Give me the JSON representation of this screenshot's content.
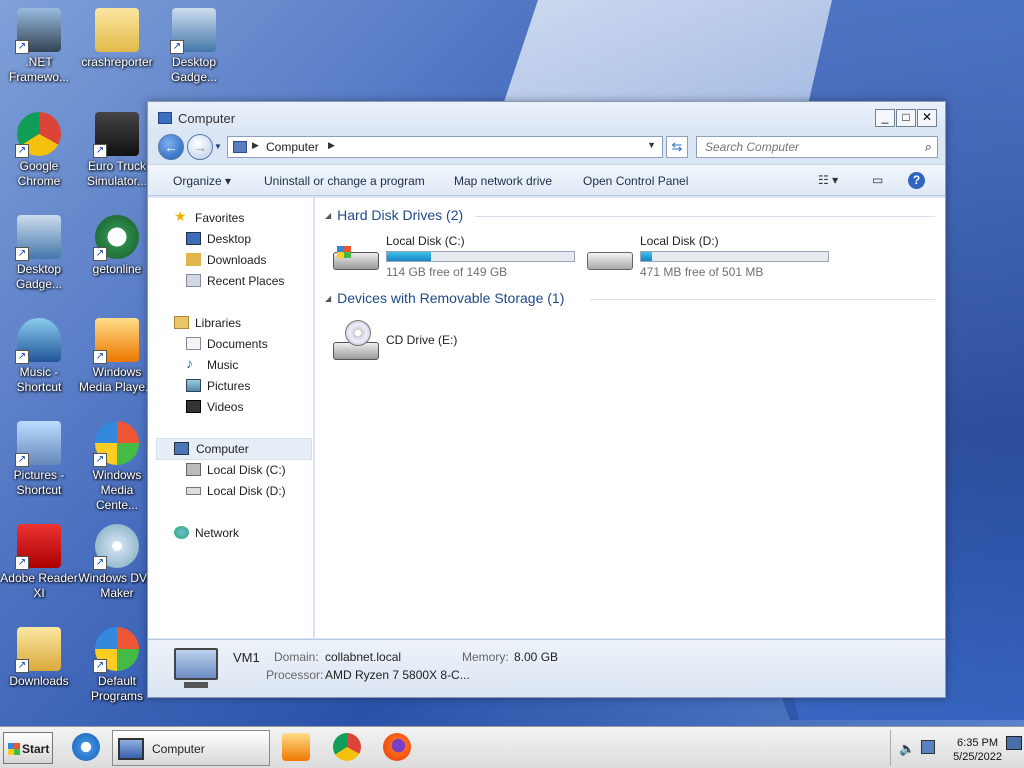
{
  "desktop": {
    "icons": [
      {
        "label": ".NET Framewo...",
        "icon": "net-framework-icon"
      },
      {
        "label": "crashreporter",
        "icon": "folder-icon"
      },
      {
        "label": "Desktop Gadge...",
        "icon": "desktop-gadget-icon"
      },
      {
        "label": "Google Chrome",
        "icon": "chrome-icon"
      },
      {
        "label": "Euro Truck Simulator...",
        "icon": "euro-truck-icon"
      },
      {
        "label": "Desktop Gadge...",
        "icon": "desktop-gadget-icon"
      },
      {
        "label": "getonline",
        "icon": "hp-icon"
      },
      {
        "label": "Music - Shortcut",
        "icon": "music-icon"
      },
      {
        "label": "Windows Media Playe...",
        "icon": "media-player-icon"
      },
      {
        "label": "Pictures - Shortcut",
        "icon": "pictures-icon"
      },
      {
        "label": "Windows Media Cente...",
        "icon": "media-center-icon"
      },
      {
        "label": "Adobe Reader XI",
        "icon": "adobe-reader-icon"
      },
      {
        "label": "Windows DVD Maker",
        "icon": "dvd-maker-icon"
      },
      {
        "label": "Downloads",
        "icon": "downloads-folder-icon"
      },
      {
        "label": "Default Programs",
        "icon": "default-programs-icon"
      }
    ]
  },
  "window": {
    "title": "Computer",
    "controls": {
      "minimize": "_",
      "maximize": "□",
      "close": "✕"
    },
    "address": {
      "crumb": "Computer"
    },
    "search": {
      "placeholder": "Search Computer"
    },
    "toolbar": {
      "organize": "Organize ▾",
      "uninstall": "Uninstall or change a program",
      "map_drive": "Map network drive",
      "control_panel": "Open Control Panel",
      "help": "?"
    },
    "nav": {
      "favorites": "Favorites",
      "desktop": "Desktop",
      "downloads": "Downloads",
      "recent": "Recent Places",
      "libraries": "Libraries",
      "documents": "Documents",
      "music": "Music",
      "pictures": "Pictures",
      "videos": "Videos",
      "computer": "Computer",
      "local_c": "Local Disk (C:)",
      "local_d": "Local Disk (D:)",
      "network": "Network"
    },
    "groups": {
      "hdd": "Hard Disk Drives (2)",
      "removable": "Devices with Removable Storage (1)"
    },
    "drives": [
      {
        "name": "Local Disk (C:)",
        "free": "114 GB free of 149 GB",
        "used_fraction": 0.235
      },
      {
        "name": "Local Disk (D:)",
        "free": "471 MB free of 501 MB",
        "used_fraction": 0.06
      }
    ],
    "cd": {
      "name": "CD Drive (E:)"
    },
    "details": {
      "name": "VM1",
      "domain_label": "Domain:",
      "domain": "collabnet.local",
      "memory_label": "Memory:",
      "memory": "8.00 GB",
      "processor_label": "Processor:",
      "processor": "AMD Ryzen 7 5800X 8-C..."
    }
  },
  "taskbar": {
    "start": "Start",
    "task_title": "Computer",
    "time": "6:35 PM",
    "date": "5/25/2022"
  },
  "colors": {
    "fill": "#1586c4",
    "accent": "#1e4a8a"
  }
}
